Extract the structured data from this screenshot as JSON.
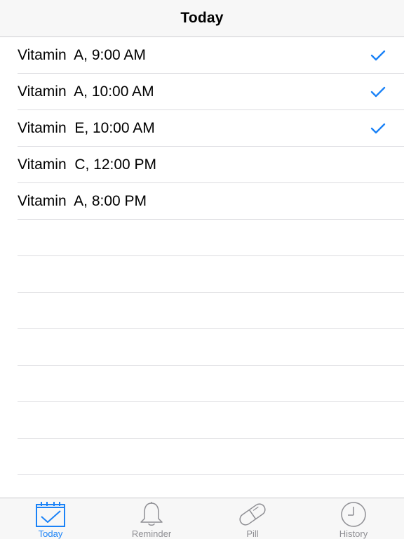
{
  "nav": {
    "title": "Today"
  },
  "reminders": [
    {
      "label": "Vitamin  A, 9:00 AM",
      "checked": true
    },
    {
      "label": "Vitamin  A, 10:00 AM",
      "checked": true
    },
    {
      "label": "Vitamin  E, 10:00 AM",
      "checked": true
    },
    {
      "label": "Vitamin  C, 12:00 PM",
      "checked": false
    },
    {
      "label": "Vitamin  A, 8:00 PM",
      "checked": false
    }
  ],
  "tabs": [
    {
      "label": "Today",
      "icon": "calendar-check-icon",
      "active": true
    },
    {
      "label": "Reminder",
      "icon": "bell-icon",
      "active": false
    },
    {
      "label": "Pill",
      "icon": "pill-icon",
      "active": false
    },
    {
      "label": "History",
      "icon": "clock-icon",
      "active": false
    }
  ],
  "colors": {
    "accent": "#1a82f7",
    "inactive": "#8e8e93",
    "separator": "#dcdce0"
  }
}
